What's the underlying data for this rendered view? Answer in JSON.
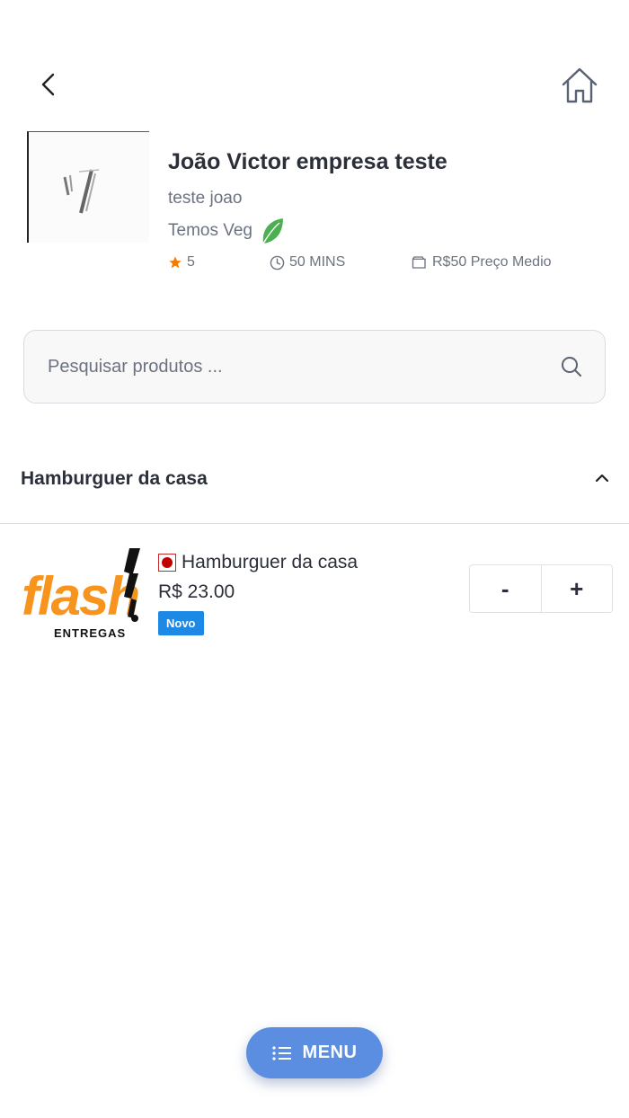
{
  "header": {
    "back_icon": "chevron-left-icon",
    "home_icon": "home-icon"
  },
  "store": {
    "name": "João Victor empresa teste",
    "description": "teste joao",
    "veg_label": "Temos Veg",
    "rating": "5",
    "time": "50 MINS",
    "price_avg": "R$50 Preço Medio"
  },
  "search": {
    "placeholder": "Pesquisar produtos ..."
  },
  "category": {
    "title": "Hamburguer da casa",
    "products": [
      {
        "name": "Hamburguer da casa",
        "price": "R$ 23.00",
        "badge": "Novo",
        "image_brand": "flash",
        "image_sub": "ENTREGAS",
        "minus_label": "-",
        "plus_label": "+"
      }
    ]
  },
  "menu": {
    "label": "MENU"
  },
  "colors": {
    "accent": "#5b8ee0",
    "badge": "#1e88e5",
    "star": "#f57c00",
    "veg_leaf": "#4caf50",
    "nonveg": "#c00000",
    "brand_orange": "#f7941d"
  }
}
